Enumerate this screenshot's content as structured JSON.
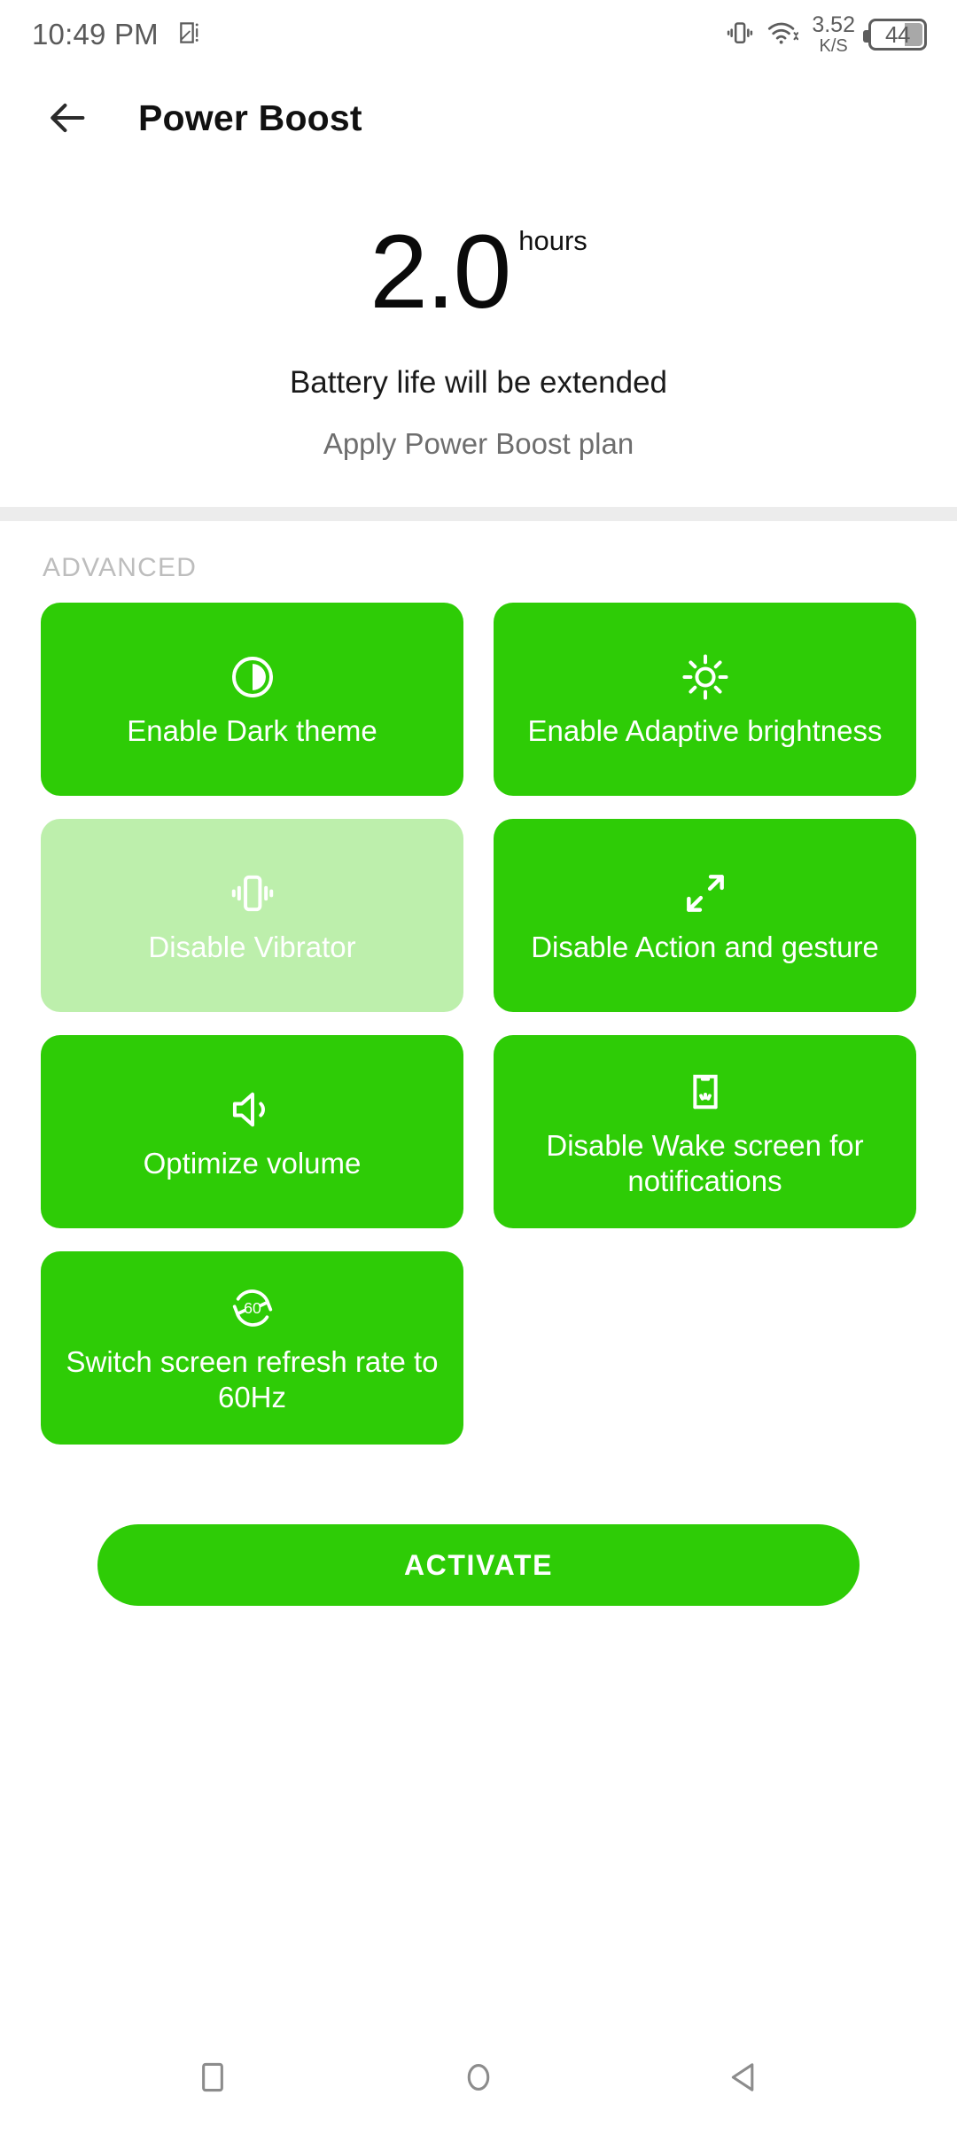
{
  "status_bar": {
    "time": "10:49 PM",
    "screenshot_icon": "screenshot-icon",
    "vibrate_icon": "vibrate-icon",
    "wifi_icon": "wifi-icon",
    "network_speed_value": "3.52",
    "network_speed_unit": "K/S",
    "battery_level": "44"
  },
  "app_bar": {
    "back_icon": "arrow-left-icon",
    "title": "Power Boost"
  },
  "hero": {
    "value": "2.0",
    "unit": "hours",
    "subtitle": "Battery life will be extended",
    "plan_text": "Apply Power Boost plan"
  },
  "advanced": {
    "section_label": "ADVANCED",
    "tiles": [
      {
        "label": "Enable Dark theme",
        "icon": "contrast-icon",
        "active": true
      },
      {
        "label": "Enable Adaptive brightness",
        "icon": "brightness-sun-icon",
        "active": true
      },
      {
        "label": "Disable Vibrator",
        "icon": "vibrate-icon",
        "active": false
      },
      {
        "label": "Disable Action and gesture",
        "icon": "expand-arrows-icon",
        "active": true
      },
      {
        "label": "Optimize volume",
        "icon": "speaker-volume-icon",
        "active": true
      },
      {
        "label": "Disable Wake screen for notifications",
        "icon": "wake-screen-icon",
        "active": true
      },
      {
        "label": "Switch screen refresh rate to 60Hz",
        "icon": "refresh-60hz-icon",
        "active": true
      }
    ]
  },
  "activate": {
    "label": "ACTIVATE"
  },
  "nav_bar": {
    "recents_icon": "square-recents-icon",
    "home_icon": "circle-home-icon",
    "back_icon": "triangle-back-icon"
  },
  "colors": {
    "accent_green": "#2ECC06",
    "inactive_green": "#BDEFAC",
    "divider_gray": "#ECECEC",
    "section_label_gray": "#BDBDBD",
    "muted_text": "#6E6E6E"
  }
}
